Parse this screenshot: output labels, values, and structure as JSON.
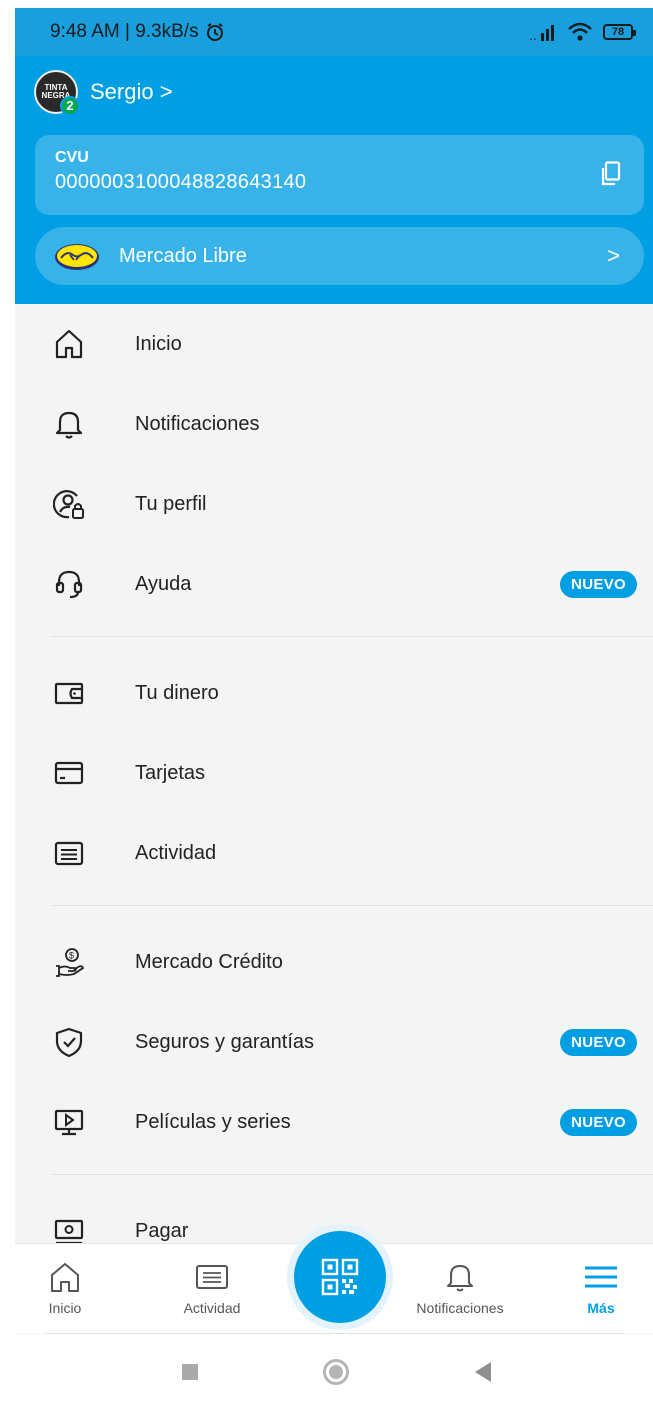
{
  "status_bar": {
    "time_speed": "9:48 AM | 9.3kB/s",
    "battery": "78"
  },
  "header": {
    "user_name": "Sergio >",
    "avatar_text": "TINTA NEGRA",
    "avatar_level": "2",
    "cvu_label": "CVU",
    "cvu_number": "0000003100048828643140",
    "ml_label": "Mercado Libre",
    "ml_chevron": ">"
  },
  "menu": {
    "section1": [
      {
        "label": "Inicio",
        "icon": "home-icon"
      },
      {
        "label": "Notificaciones",
        "icon": "bell-icon"
      },
      {
        "label": "Tu perfil",
        "icon": "profile-lock-icon"
      },
      {
        "label": "Ayuda",
        "icon": "headset-icon",
        "badge": "NUEVO"
      }
    ],
    "section2": [
      {
        "label": "Tu dinero",
        "icon": "wallet-icon"
      },
      {
        "label": "Tarjetas",
        "icon": "card-icon"
      },
      {
        "label": "Actividad",
        "icon": "activity-icon"
      }
    ],
    "section3": [
      {
        "label": "Mercado Crédito",
        "icon": "credit-hand-icon"
      },
      {
        "label": "Seguros y garantías",
        "icon": "shield-check-icon",
        "badge": "NUEVO"
      },
      {
        "label": "Películas y series",
        "icon": "play-screen-icon",
        "badge": "NUEVO"
      }
    ],
    "section4": [
      {
        "label": "Pagar",
        "icon": "pay-icon"
      }
    ]
  },
  "bottom_nav": {
    "inicio": "Inicio",
    "actividad": "Actividad",
    "notificaciones": "Notificaciones",
    "mas": "Más"
  },
  "colors": {
    "brand_blue": "#009ee3",
    "status_blue": "#1a9fde",
    "background": "#f4f4f4"
  }
}
